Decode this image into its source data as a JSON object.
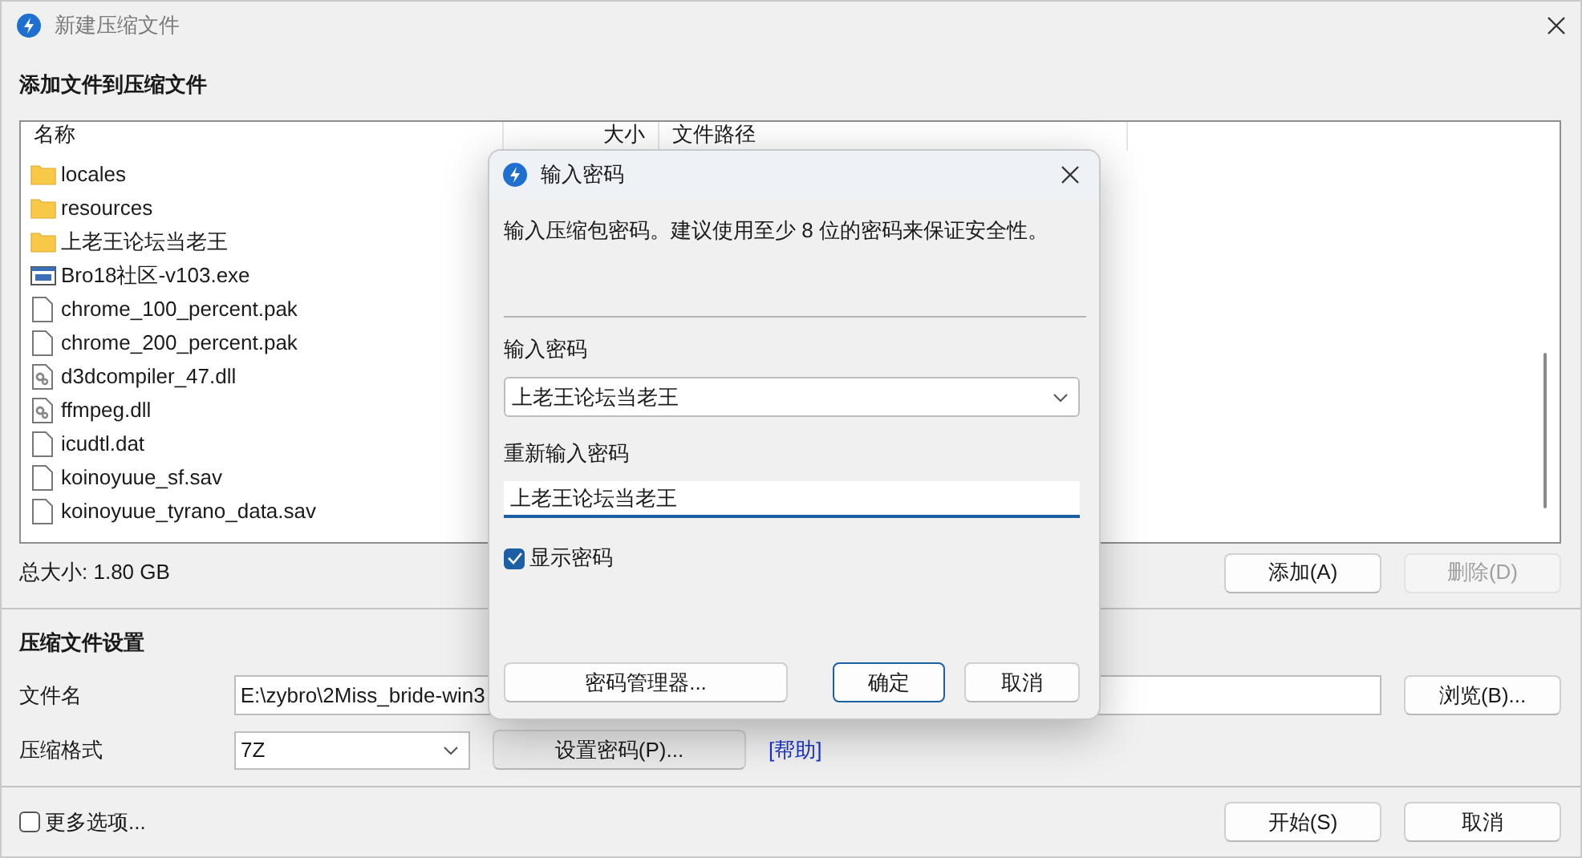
{
  "window": {
    "title": "新建压缩文件"
  },
  "add_section": {
    "title": "添加文件到压缩文件",
    "columns": [
      "名称",
      "大小",
      "文件路径"
    ],
    "files": [
      {
        "name": "locales",
        "kind": "folder"
      },
      {
        "name": "resources",
        "kind": "folder"
      },
      {
        "name": "上老王论坛当老王",
        "kind": "folder"
      },
      {
        "name": "Bro18社区-v103.exe",
        "kind": "exe"
      },
      {
        "name": "chrome_100_percent.pak",
        "kind": "file"
      },
      {
        "name": "chrome_200_percent.pak",
        "kind": "file"
      },
      {
        "name": "d3dcompiler_47.dll",
        "kind": "dll"
      },
      {
        "name": "ffmpeg.dll",
        "kind": "dll"
      },
      {
        "name": "icudtl.dat",
        "kind": "file"
      },
      {
        "name": "koinoyuue_sf.sav",
        "kind": "file"
      },
      {
        "name": "koinoyuue_tyrano_data.sav",
        "kind": "file"
      }
    ],
    "total": "总大小: 1.80 GB",
    "buttons": [
      {
        "label": "添加(A)",
        "disabled": false
      },
      {
        "label": "删除(D)",
        "disabled": true
      }
    ]
  },
  "settings": {
    "title": "压缩文件设置",
    "filename_label": "文件名",
    "filename_value": "E:\\zybro\\2Miss_bride-win3",
    "browse_button": "浏览(B)...",
    "format_label": "压缩格式",
    "format_value": "7Z",
    "password_button": "设置密码(P)...",
    "help_link": "[帮助]"
  },
  "footer": {
    "more_options": {
      "label": "更多选项...",
      "checked": false
    },
    "buttons": [
      "开始(S)",
      "取消"
    ]
  },
  "dialog": {
    "title": "输入密码",
    "message": "输入压缩包密码。建议使用至少 8 位的密码来保证安全性。",
    "password_label": "输入密码",
    "password_value": "上老王论坛当老王",
    "confirm_label": "重新输入密码",
    "confirm_value": "上老王论坛当老王",
    "show_password": {
      "label": "显示密码",
      "checked": true
    },
    "buttons": [
      {
        "label": "密码管理器...",
        "default": false
      },
      {
        "label": "确定",
        "default": true
      },
      {
        "label": "取消",
        "default": false
      }
    ]
  }
}
